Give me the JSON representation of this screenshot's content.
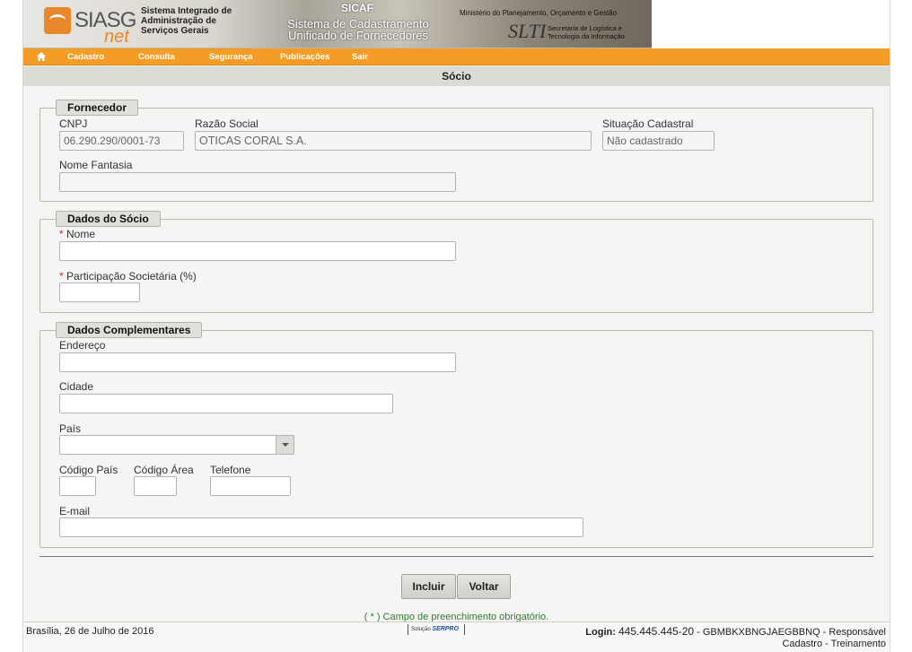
{
  "header": {
    "siasg_logo": "SIASG",
    "net_logo": "net",
    "system_name": "Sistema Integrado de\nAdministração de\nServiços Gerais",
    "sicaf_title": "SICAF",
    "sicaf_subtitle": "Sistema de Cadastramento\nUnificado de Fornecedores",
    "ministry": "Ministério do Planejamento, Orçamento e Gestão",
    "slti_logo": "SLTI",
    "slti_name": "Secretaria de Logística e\nTecnologia da Informação"
  },
  "nav": {
    "home_icon": "home-icon",
    "items": [
      "Cadastro",
      "Consulta",
      "Segurança",
      "Publicações",
      "Sair"
    ]
  },
  "page_title": "Sócio",
  "fornecedor": {
    "legend": "Fornecedor",
    "cnpj_label": "CNPJ",
    "cnpj_value": "06.290.290/0001-73",
    "razao_label": "Razão Social",
    "razao_value": "OTICAS CORAL S.A.",
    "situacao_label": "Situação Cadastral",
    "situacao_value": "Não cadastrado",
    "fantasia_label": "Nome Fantasia",
    "fantasia_value": ""
  },
  "socio": {
    "legend": "Dados do Sócio",
    "required_mark": "*",
    "nome_label": "Nome",
    "nome_value": "",
    "participacao_label": "Participação Societária (%)",
    "participacao_value": ""
  },
  "complementares": {
    "legend": "Dados Complementares",
    "endereco_label": "Endereço",
    "cidade_label": "Cidade",
    "pais_label": "País",
    "pais_value": "",
    "codigo_pais_label": "Código País",
    "codigo_area_label": "Código Área",
    "telefone_label": "Telefone",
    "email_label": "E-mail"
  },
  "buttons": {
    "incluir": "Incluir",
    "voltar": "Voltar"
  },
  "required_note": "( * ) Campo de preenchimento obrigatório.",
  "footer": {
    "date": "Brasília, 26 de Julho de 2016",
    "solution": "Solução",
    "serpro": "SERPRO",
    "login_label": "Login:",
    "login_value": "445.445.445-20",
    "login_detail": " - GBMBKXBNGJAEGBBNQ - Responsável",
    "login_role": "Cadastro - Treinamento"
  },
  "colors": {
    "accent": "#f39c26",
    "required": "#c0282e",
    "note": "#2e7d2e"
  }
}
